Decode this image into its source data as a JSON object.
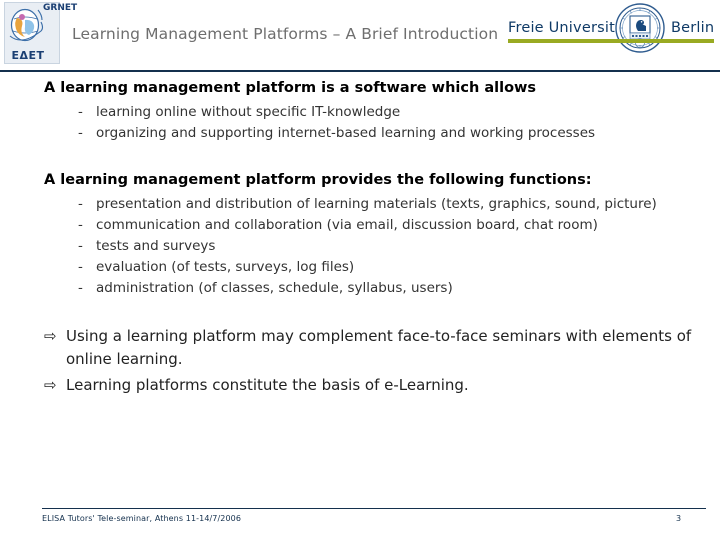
{
  "header": {
    "title": "Learning Management Platforms – A Brief Introduction",
    "left_logo": {
      "acronym_vertical": "GRNET",
      "acronym_greek": "ΕΔΕΤ",
      "icon": "globe-icon"
    },
    "right_logo": {
      "word_left": "Freie Universität",
      "word_right": "Berlin",
      "seal_icon": "university-seal-icon",
      "rule_color": "#99aa22"
    },
    "rule_color": "#14304d"
  },
  "content": {
    "sections": [
      {
        "lead": "A learning management platform is a software which allows",
        "bullet_marker": "-",
        "items": [
          "learning online without specific IT-knowledge",
          "organizing and supporting internet-based learning and working processes"
        ]
      },
      {
        "lead": "A learning management platform provides the following functions:",
        "bullet_marker": "-",
        "items": [
          "presentation and distribution of learning materials (texts, graphics, sound, picture)",
          "communication and collaboration (via email, discussion board, chat room)",
          "tests and surveys",
          "evaluation (of tests, surveys, log files)",
          "administration (of classes, schedule, syllabus, users)"
        ]
      }
    ],
    "conclusions": {
      "bullet_marker": "⇨",
      "items": [
        "Using a learning platform may complement face-to-face seminars with elements of online learning.",
        "Learning platforms constitute the basis of e-Learning."
      ]
    }
  },
  "footer": {
    "text": "ELISA Tutors' Tele-seminar, Athens 11-14/7/2006",
    "page_number": "3"
  }
}
